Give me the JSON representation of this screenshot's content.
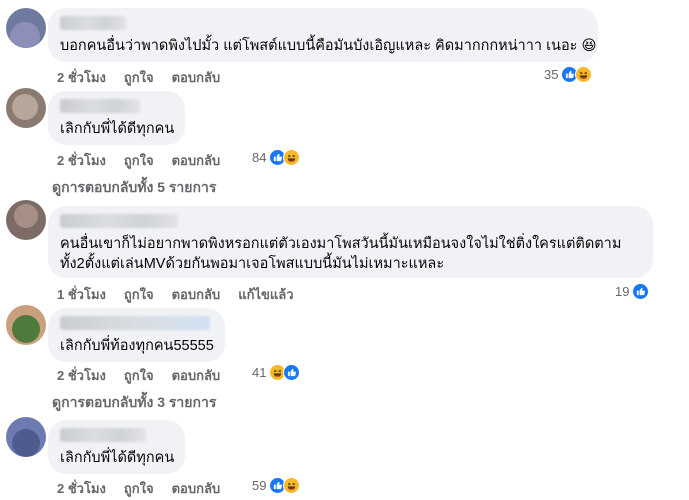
{
  "comments": [
    {
      "text": "บอกคนอื่นว่าพาดพิงไปมั้ว แต่โพสต์แบบนี้คือมันบังเอิญแหละ คิดมากกกหน่าาา เนอะ 😆",
      "time": "2 ชั่วโมง",
      "like_label": "ถูกใจ",
      "reply_label": "ตอบกลับ",
      "reaction_count": "35",
      "reactions": [
        "like-icon",
        "haha-icon"
      ]
    },
    {
      "text": "เลิกกับพี่ได้ดีทุกคน",
      "time": "2 ชั่วโมง",
      "like_label": "ถูกใจ",
      "reply_label": "ตอบกลับ",
      "reaction_count": "84",
      "reactions": [
        "like-icon",
        "haha-icon"
      ],
      "view_replies": "ดูการตอบกลับทั้ง 5 รายการ"
    },
    {
      "text_line1": "คนอื่นเขาก็ไม่อยากพาดพิงหรอกแต่ตัวเองมาโพสวันนี้มันเหมือนจงใจไม่ใช่ติ่งใครแต่ติดตาม",
      "text_line2": "ทั้ง2ตั้งแต่เล่นMVด้วยกันพอมาเจอโพสแบบนี้มันไม่เหมาะแหละ",
      "time": "1 ชั่วโมง",
      "like_label": "ถูกใจ",
      "reply_label": "ตอบกลับ",
      "edited_label": "แก้ไขแล้ว",
      "reaction_count": "19",
      "reactions": [
        "like-icon"
      ]
    },
    {
      "text": "เลิกกับพี่ท้องทุกคน55555",
      "time": "2 ชั่วโมง",
      "like_label": "ถูกใจ",
      "reply_label": "ตอบกลับ",
      "reaction_count": "41",
      "reactions": [
        "haha-icon",
        "like-icon"
      ],
      "view_replies": "ดูการตอบกลับทั้ง 3 รายการ"
    },
    {
      "text": "เลิกกับพี่ได้ดีทุกคน",
      "time": "2 ชั่วโมง",
      "like_label": "ถูกใจ",
      "reply_label": "ตอบกลับ",
      "reaction_count": "59",
      "reactions": [
        "like-icon",
        "haha-icon"
      ]
    }
  ],
  "colors": {
    "bubble": "#f0f2f5",
    "meta_text": "#65676b",
    "like": "#1877f2",
    "haha": "#f7b928"
  }
}
